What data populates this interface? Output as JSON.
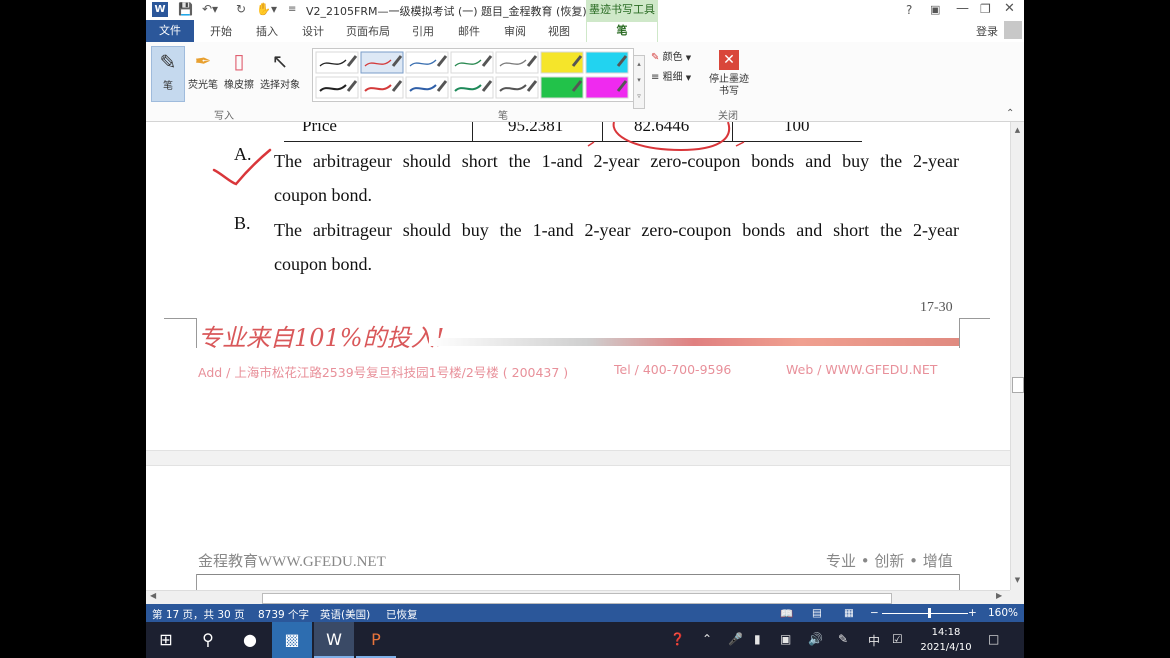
{
  "title_bar": {
    "app_icon": "W",
    "doc_title": "V2_2105FRM—一级模拟考试 (一) 题目_金程教育 (恢复)...",
    "context_tab_group": "墨迹书写工具",
    "help": "?",
    "window_controls": [
      "—",
      "❐",
      "✕"
    ]
  },
  "tabs": {
    "file": "文件",
    "items": [
      "开始",
      "插入",
      "设计",
      "页面布局",
      "引用",
      "邮件",
      "审阅",
      "视图"
    ],
    "active": "笔",
    "login": "登录"
  },
  "ribbon": {
    "write_group": {
      "label": "写入",
      "pen": "笔",
      "highlighter": "荧光笔",
      "eraser": "橡皮擦",
      "select": "选择对象"
    },
    "pens_group": {
      "label": "笔",
      "color": "颜色",
      "thickness": "粗细",
      "swatch_colors": [
        "#222222",
        "#d43b3b",
        "#3a6fb0",
        "#2b8a52",
        "#7a7a7a",
        "#f5e52a",
        "#22d3f0",
        "#222222",
        "#d43b3b",
        "#2f5fa8",
        "#1f8a5a",
        "#555555",
        "#22c24a",
        "#ef2aef"
      ]
    },
    "close_group": {
      "label": "关闭",
      "stop_inking": "停止墨迹书写"
    }
  },
  "document": {
    "table_row": {
      "label": "Price",
      "cells": [
        "95.2381",
        "82.6446",
        "100"
      ]
    },
    "options": [
      {
        "letter": "A.",
        "line1": "The arbitrageur should short the 1-and 2-year zero-coupon bonds and buy the 2-year",
        "line2": "coupon bond."
      },
      {
        "letter": "B.",
        "line1": "The arbitrageur should buy the 1-and 2-year zero-coupon bonds and short the 2-year",
        "line2": "coupon bond."
      }
    ],
    "page_number": "17-30",
    "slogan": "专业来自101%的投入!",
    "footer": {
      "address": "Add / 上海市松花江路2539号复旦科技园1号楼/2号楼 ( 200437 )",
      "tel": "Tel / 400-700-9596",
      "web": "Web / WWW.GFEDU.NET"
    },
    "next_header": {
      "left": "金程教育WWW.GFEDU.NET",
      "right": "专业 • 创新 • 增值"
    },
    "ink_color": "#d9363a"
  },
  "status_bar": {
    "page": "第 17 页，共 30 页",
    "words": "8739 个字",
    "language": "英语(美国)",
    "recovered": "已恢复",
    "zoom": "160%"
  },
  "taskbar": {
    "ime": "中",
    "time": "14:18",
    "date": "2021/4/10"
  }
}
